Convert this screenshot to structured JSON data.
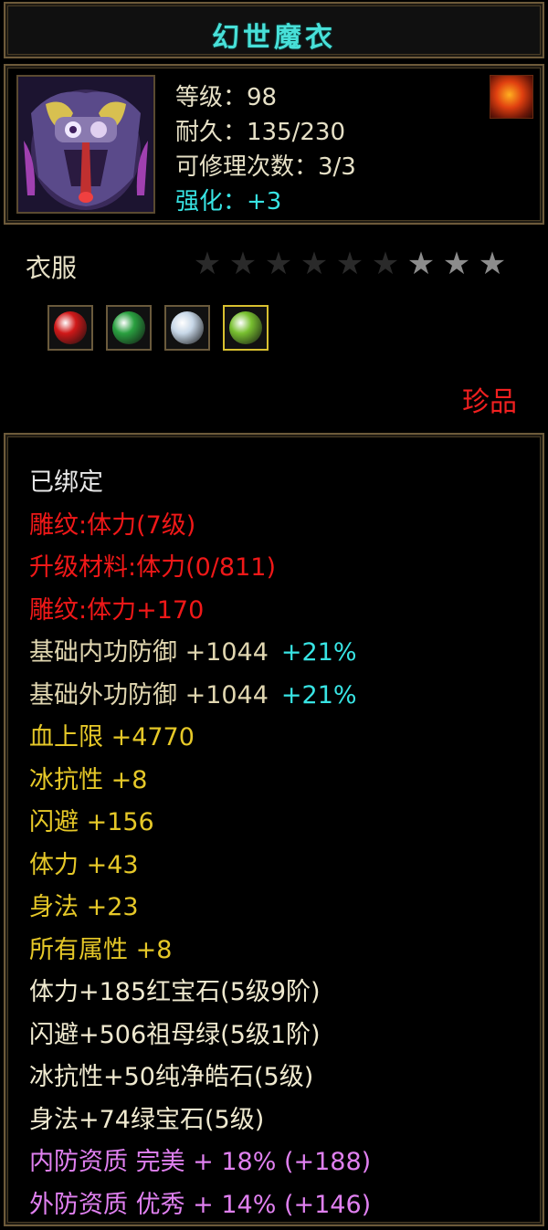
{
  "item": {
    "name": "幻世魔衣",
    "level_label": "等级：98",
    "durability_label": "耐久：135/230",
    "repair_label": "可修理次数：3/3",
    "enhance_label": "强化：+3",
    "type": "衣服",
    "rarity": "珍品"
  },
  "stars": {
    "total": 9,
    "filled_dim": 6,
    "lit": 3
  },
  "gems": [
    {
      "name": "red-gem",
      "color": "#d01818",
      "selected": false
    },
    {
      "name": "emerald-gem",
      "color": "#2aa040",
      "selected": false
    },
    {
      "name": "diamond-gem",
      "color": "#c8d8e8",
      "selected": false
    },
    {
      "name": "green-gem",
      "color": "#78c030",
      "selected": true
    }
  ],
  "attributes": [
    {
      "text": "已绑定",
      "color": "white"
    },
    {
      "text": "雕纹:体力(7级)",
      "color": "red"
    },
    {
      "text": "升级材料:体力(0/811)",
      "color": "red"
    },
    {
      "text": "雕纹:体力+170",
      "color": "red"
    },
    {
      "text": "基础内功防御  +1044",
      "extra": "+21%",
      "color": "tan"
    },
    {
      "text": "基础外功防御  +1044",
      "extra": "+21%",
      "color": "tan"
    },
    {
      "text": "血上限  +4770",
      "color": "yellow"
    },
    {
      "text": "冰抗性  +8",
      "color": "yellow"
    },
    {
      "text": "闪避  +156",
      "color": "yellow"
    },
    {
      "text": "体力  +43",
      "color": "yellow"
    },
    {
      "text": "身法  +23",
      "color": "yellow"
    },
    {
      "text": "所有属性  +8",
      "color": "yellow"
    },
    {
      "text": "体力+185红宝石(5级9阶)",
      "color": "cream"
    },
    {
      "text": "闪避+506祖母绿(5级1阶)",
      "color": "cream"
    },
    {
      "text": "冰抗性+50纯净皓石(5级)",
      "color": "cream"
    },
    {
      "text": "身法+74绿宝石(5级)",
      "color": "cream"
    },
    {
      "text": "内防资质  完美  + 18% (+188)",
      "color": "pink"
    },
    {
      "text": "外防资质  优秀  + 14% (+146)",
      "color": "pink"
    }
  ],
  "colors": {
    "title": "#48e0d8",
    "rarity": "#f02020",
    "border": "#6d5a3a"
  }
}
